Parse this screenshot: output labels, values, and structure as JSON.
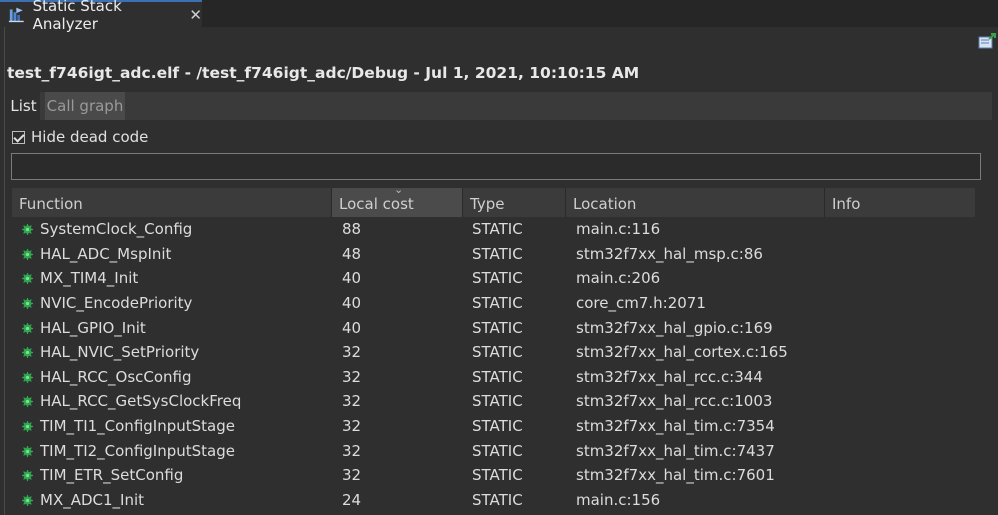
{
  "view": {
    "title": "Static Stack Analyzer",
    "icon": "stack-analyzer-icon",
    "close_icon": "close-icon"
  },
  "header": {
    "title": "test_f746igt_adc.elf - /test_f746igt_adc/Debug - Jul 1, 2021, 10:10:15 AM"
  },
  "tabs": [
    {
      "label": "List"
    },
    {
      "label": "Call graph"
    }
  ],
  "filter": {
    "hide_dead_code_label": "Hide dead code",
    "checked": true,
    "search_value": ""
  },
  "table": {
    "columns": [
      "Function",
      "Local cost",
      "Type",
      "Location",
      "Info"
    ],
    "sorted_column": "Local cost",
    "rows": [
      {
        "function": "SystemClock_Config",
        "cost": "88",
        "type": "STATIC",
        "location": "main.c:116",
        "info": ""
      },
      {
        "function": "HAL_ADC_MspInit",
        "cost": "48",
        "type": "STATIC",
        "location": "stm32f7xx_hal_msp.c:86",
        "info": ""
      },
      {
        "function": "MX_TIM4_Init",
        "cost": "40",
        "type": "STATIC",
        "location": "main.c:206",
        "info": ""
      },
      {
        "function": "NVIC_EncodePriority",
        "cost": "40",
        "type": "STATIC",
        "location": "core_cm7.h:2071",
        "info": ""
      },
      {
        "function": "HAL_GPIO_Init",
        "cost": "40",
        "type": "STATIC",
        "location": "stm32f7xx_hal_gpio.c:169",
        "info": ""
      },
      {
        "function": "HAL_NVIC_SetPriority",
        "cost": "32",
        "type": "STATIC",
        "location": "stm32f7xx_hal_cortex.c:165",
        "info": ""
      },
      {
        "function": "HAL_RCC_OscConfig",
        "cost": "32",
        "type": "STATIC",
        "location": "stm32f7xx_hal_rcc.c:344",
        "info": ""
      },
      {
        "function": "HAL_RCC_GetSysClockFreq",
        "cost": "32",
        "type": "STATIC",
        "location": "stm32f7xx_hal_rcc.c:1003",
        "info": ""
      },
      {
        "function": "TIM_TI1_ConfigInputStage",
        "cost": "32",
        "type": "STATIC",
        "location": "stm32f7xx_hal_tim.c:7354",
        "info": ""
      },
      {
        "function": "TIM_TI2_ConfigInputStage",
        "cost": "32",
        "type": "STATIC",
        "location": "stm32f7xx_hal_tim.c:7437",
        "info": ""
      },
      {
        "function": "TIM_ETR_SetConfig",
        "cost": "32",
        "type": "STATIC",
        "location": "stm32f7xx_hal_tim.c:7601",
        "info": ""
      },
      {
        "function": "MX_ADC1_Init",
        "cost": "24",
        "type": "STATIC",
        "location": "main.c:156",
        "info": ""
      }
    ]
  },
  "colors": {
    "background": "#2f2f2f",
    "tab_accent": "#3d6fb4",
    "function_icon": "#2fa84f"
  }
}
